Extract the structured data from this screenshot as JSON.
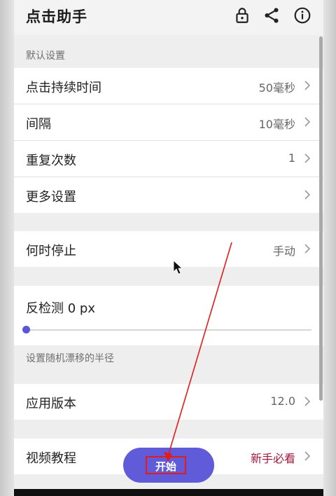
{
  "app": {
    "title": "点击助手"
  },
  "toolbar": {
    "icons": [
      "lock-icon",
      "share-icon",
      "info-icon"
    ]
  },
  "sections": {
    "default_settings_header": "默认设置",
    "drift_note": "设置随机漂移的半径"
  },
  "rows": {
    "click_duration": {
      "label": "点击持续时间",
      "value": "50毫秒"
    },
    "interval": {
      "label": "间隔",
      "value": "10毫秒"
    },
    "repeat_count": {
      "label": "重复次数",
      "value": "1"
    },
    "more_settings": {
      "label": "更多设置"
    },
    "when_stop": {
      "label": "何时停止",
      "value": "手动"
    },
    "anti_detect": {
      "label": "反检测 0 px",
      "slider_value": 0
    },
    "app_version": {
      "label": "应用版本",
      "value": "12.0"
    },
    "video_tutorial": {
      "label": "视频教程",
      "value": "新手必看"
    }
  },
  "fab": {
    "label": "开始"
  },
  "colors": {
    "accent": "#5f5bd9",
    "annotation": "#e31b1b",
    "tutorial_value": "#a0183a"
  }
}
